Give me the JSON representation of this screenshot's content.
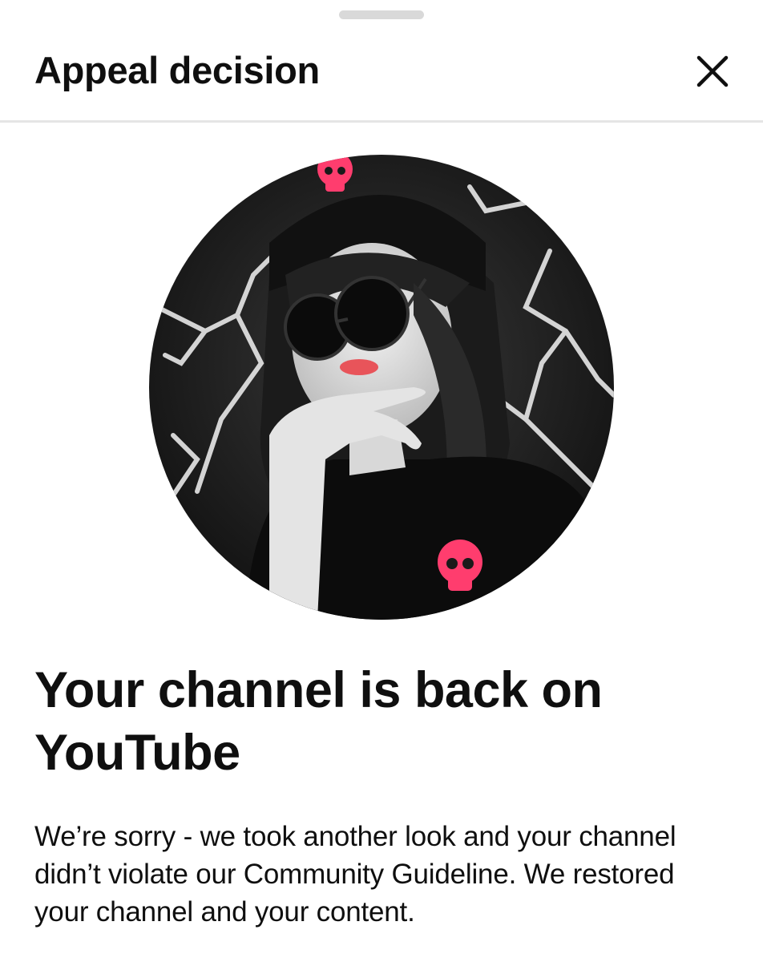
{
  "dialog": {
    "title": "Appeal decision",
    "close_icon": "close-icon"
  },
  "avatar": {
    "description_icon": "channel-avatar"
  },
  "content": {
    "heading": "Your channel is back on YouTube",
    "message": "We’re sorry - we took another look and your channel didn’t violate our Community Guideline. We restored your channel and your content."
  },
  "colors": {
    "text": "#0f0f0f",
    "divider": "#e5e5e5",
    "handle": "#d9d9d9",
    "accent_pink": "#ff3d6e"
  }
}
